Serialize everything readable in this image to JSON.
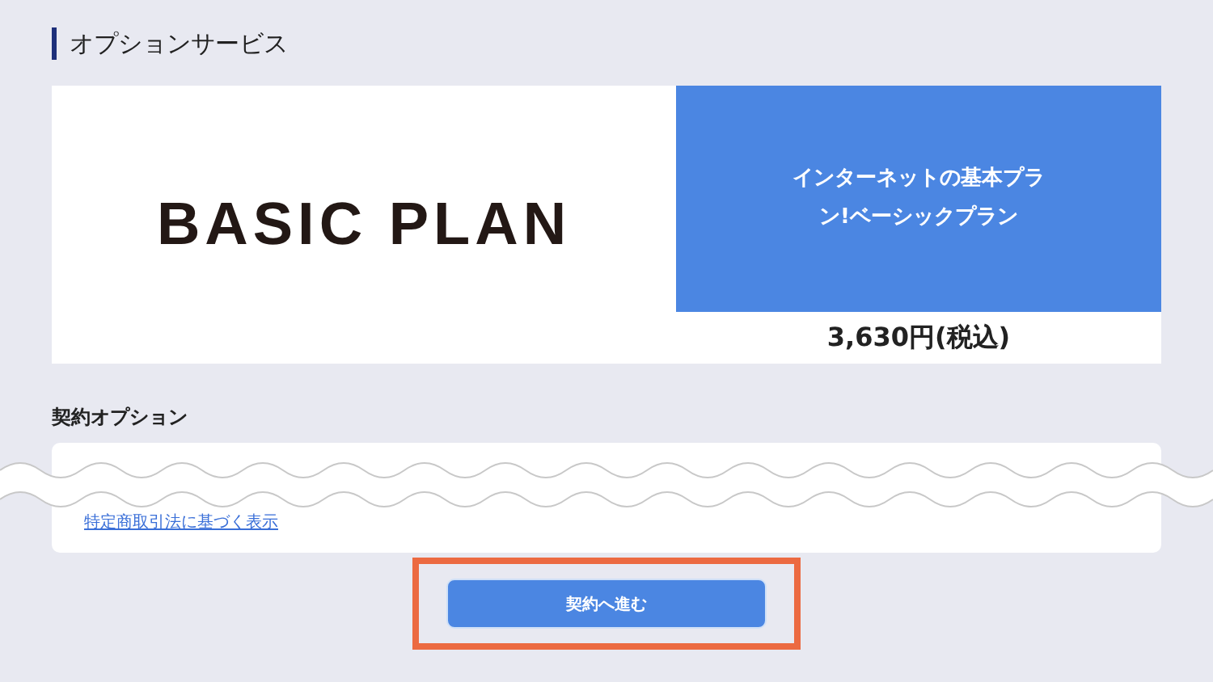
{
  "section_title": "オプションサービス",
  "plan": {
    "logo_text": "BASIC PLAN",
    "name": "インターネットの基本プラン!ベーシックプラン",
    "price": "3,630円(税込)"
  },
  "options": {
    "title": "契約オプション",
    "link": "特定商取引法に基づく表示"
  },
  "submit": {
    "label": "契約へ進む",
    "highlighted": true
  }
}
